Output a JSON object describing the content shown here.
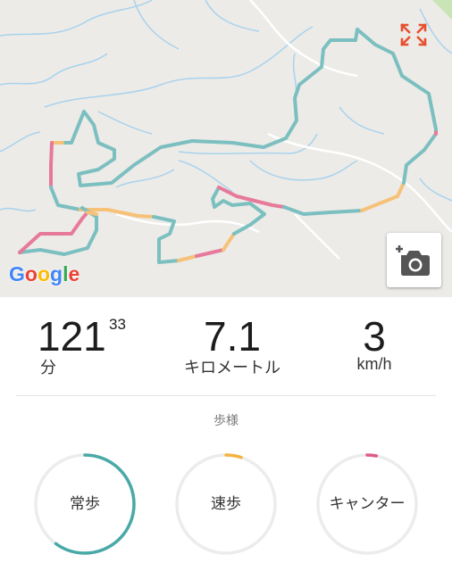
{
  "map": {
    "attribution": "Google",
    "fullscreen_icon": "expand-arrows-icon",
    "camera_icon": "add-photo-camera-icon",
    "colors": {
      "background": "#ecebe8",
      "rivers": "#a9d2ec",
      "roads": "#ffffff",
      "route_walk": "#7cbfc0",
      "route_brisk": "#f6c178",
      "route_canter": "#e7799a",
      "accent": "#e8502f"
    }
  },
  "stats": {
    "time": {
      "value": "121",
      "seconds": "33",
      "unit": "分"
    },
    "distance": {
      "value": "7.1",
      "unit": "キロメートル"
    },
    "speed": {
      "value": "3",
      "unit": "km/h"
    }
  },
  "gait": {
    "title": "歩様",
    "items": [
      {
        "label": "常歩",
        "fraction": 0.6,
        "color": "#48a9a6"
      },
      {
        "label": "速歩",
        "fraction": 0.05,
        "color": "#f6b23f"
      },
      {
        "label": "キャンター",
        "fraction": 0.03,
        "color": "#e05a86"
      }
    ],
    "track_color": "#ececec"
  }
}
